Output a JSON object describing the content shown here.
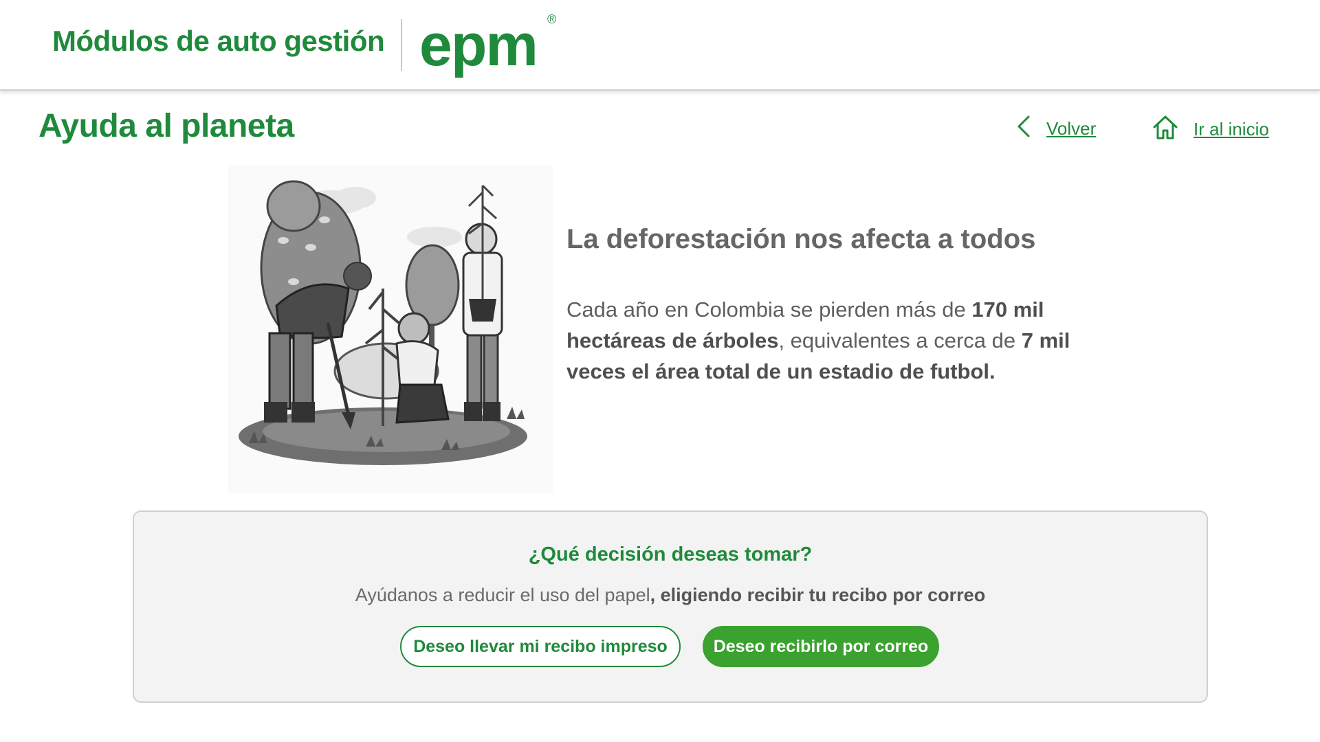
{
  "header": {
    "app_title": "Módulos de auto gestión",
    "logo_text": "epm",
    "logo_reg": "®"
  },
  "page": {
    "title": "Ayuda al planeta",
    "back_label": "Volver",
    "home_label": "Ir al inicio"
  },
  "info": {
    "heading": "La deforestación nos afecta a todos",
    "body_part1": "Cada año en Colombia se pierden más de ",
    "body_bold1": "170 mil hectáreas de árboles",
    "body_part2": ", equivalentes a cerca de ",
    "body_bold2": "7 mil veces el área total de un estadio de futbol",
    "body_part3": "."
  },
  "decision": {
    "title": "¿Qué decisión deseas tomar?",
    "text_plain": "Ayúdanos a reducir el uso del papel",
    "text_bold": ", eligiendo recibir tu recibo por correo",
    "btn_printed": "Deseo llevar mi recibo impreso",
    "btn_email": "Deseo recibirlo por correo"
  },
  "icons": {
    "back": "chevron-left-icon",
    "home": "home-icon",
    "illustration": "people-planting-trees-illustration"
  },
  "colors": {
    "brand_green": "#1f8a3c",
    "button_green": "#3ba12f",
    "card_bg": "#f3f3f3",
    "text_gray": "#5f5f5f"
  }
}
